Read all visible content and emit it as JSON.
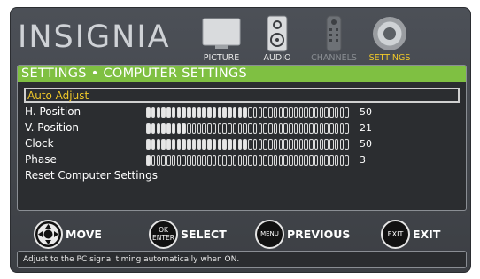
{
  "brand": {
    "logo_text": "INSIGNIA"
  },
  "tabs": [
    {
      "label": "PICTURE",
      "icon": "tv-icon",
      "state": "normal"
    },
    {
      "label": "AUDIO",
      "icon": "speaker-icon",
      "state": "normal"
    },
    {
      "label": "CHANNELS",
      "icon": "remote-icon",
      "state": "dim"
    },
    {
      "label": "SETTINGS",
      "icon": "gear-icon",
      "state": "active"
    }
  ],
  "panel": {
    "title": "SETTINGS • COMPUTER SETTINGS",
    "items": [
      {
        "label": "Auto Adjust"
      },
      {
        "label": "H. Position",
        "value": "50",
        "level": 50,
        "max": 100
      },
      {
        "label": "V. Position",
        "value": "21",
        "level": 21,
        "max": 100
      },
      {
        "label": "Clock",
        "value": "50",
        "level": 50,
        "max": 100
      },
      {
        "label": "Phase",
        "value": "3",
        "level": 3,
        "max": 100
      },
      {
        "label": "Reset Computer Settings"
      }
    ]
  },
  "legend": [
    {
      "button": "",
      "icon": "dpad-icon",
      "label": "MOVE"
    },
    {
      "button": "OK\nENTER",
      "icon": "ok-enter-button-icon",
      "label": "SELECT"
    },
    {
      "button": "MENU",
      "icon": "menu-button-icon",
      "label": "PREVIOUS"
    },
    {
      "button": "EXIT",
      "icon": "exit-button-icon",
      "label": "EXIT"
    }
  ],
  "help_text": "Adjust to the PC signal timing automatically when ON.",
  "colors": {
    "accent_green": "#7fc042",
    "highlight_yellow": "#f0c829"
  }
}
